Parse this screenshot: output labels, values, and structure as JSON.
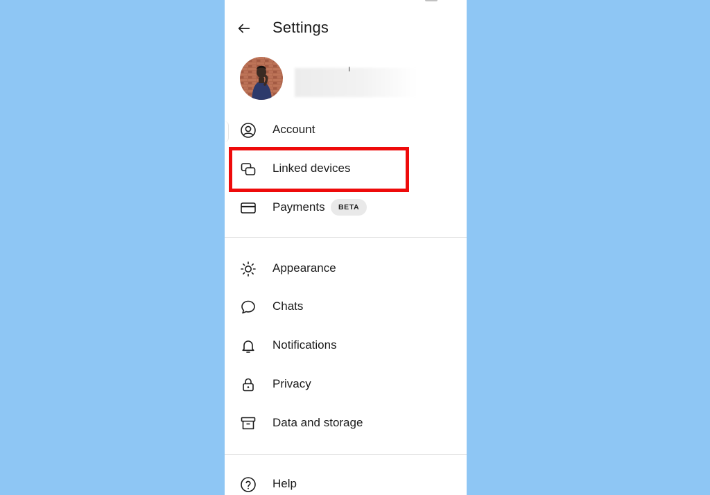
{
  "app_bar": {
    "title": "Settings",
    "back_icon": "arrow-left-icon"
  },
  "profile": {
    "avatar_icon": "profile-photo",
    "name_hint": "ı"
  },
  "menu_group_1": [
    {
      "label": "Account",
      "icon": "account-circle-icon"
    },
    {
      "label": "Linked devices",
      "icon": "linked-devices-icon",
      "highlighted": true
    },
    {
      "label": "Payments",
      "icon": "credit-card-icon",
      "badge": "BETA"
    }
  ],
  "menu_group_2": [
    {
      "label": "Appearance",
      "icon": "sun-icon"
    },
    {
      "label": "Chats",
      "icon": "chat-bubble-icon"
    },
    {
      "label": "Notifications",
      "icon": "bell-icon"
    },
    {
      "label": "Privacy",
      "icon": "lock-icon"
    },
    {
      "label": "Data and storage",
      "icon": "archive-box-icon"
    }
  ],
  "menu_group_3": [
    {
      "label": "Help",
      "icon": "help-circle-icon"
    }
  ],
  "colors": {
    "background": "#8ec6f4",
    "panel": "#ffffff",
    "text": "#1b1b1b",
    "highlight": "#ee0b0b",
    "badge_bg": "#e9e9e9"
  }
}
